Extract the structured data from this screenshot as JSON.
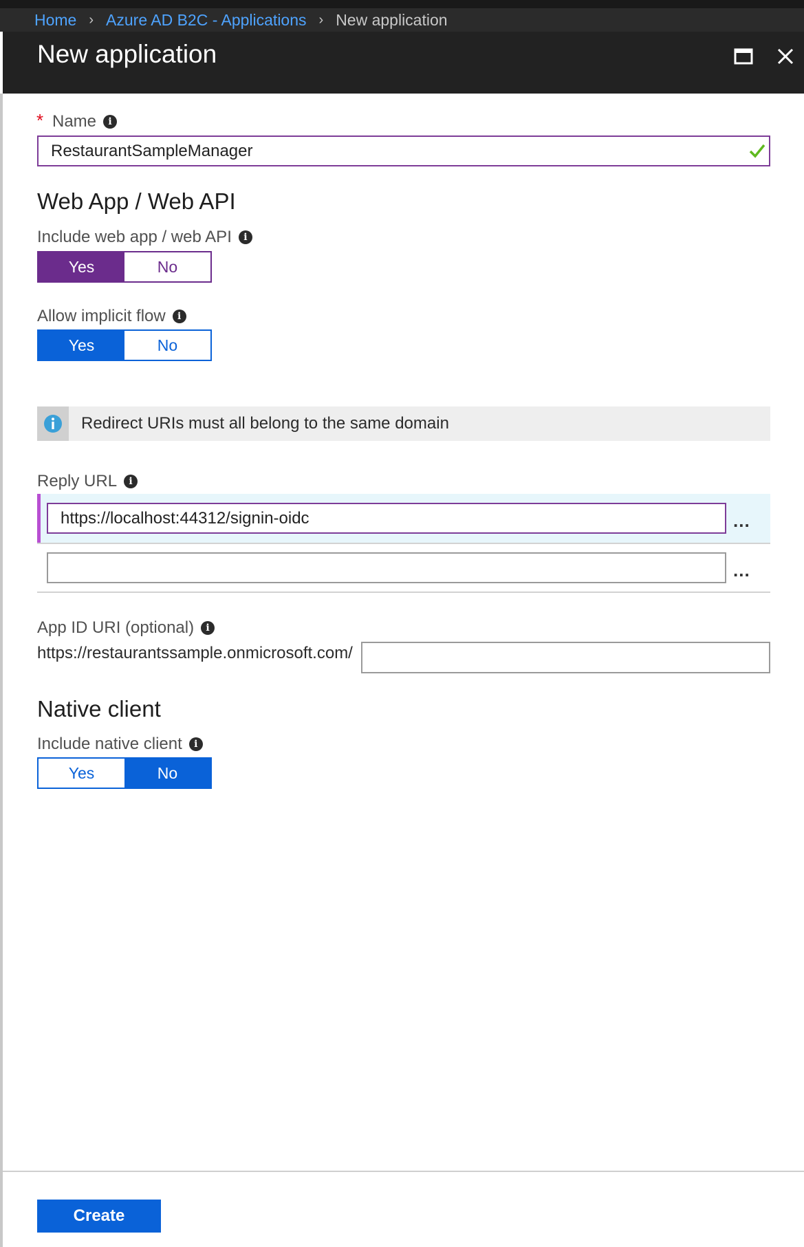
{
  "breadcrumb": {
    "items": [
      "Home",
      "Azure AD B2C - Applications",
      "New application"
    ]
  },
  "header": {
    "title": "New application"
  },
  "name_field": {
    "label": "Name",
    "required_mark": "*",
    "value": "RestaurantSampleManager",
    "valid": true
  },
  "web_app": {
    "section_title": "Web App / Web API",
    "include_label": "Include web app / web API",
    "include_options": [
      "Yes",
      "No"
    ],
    "include_selected": "Yes",
    "implicit_label": "Allow implicit flow",
    "implicit_options": [
      "Yes",
      "No"
    ],
    "implicit_selected": "Yes"
  },
  "info_banner": {
    "text": "Redirect URIs must all belong to the same domain",
    "icon": "info-icon"
  },
  "reply_url": {
    "label": "Reply URL",
    "values": [
      "https://localhost:44312/signin-oidc",
      ""
    ],
    "more_label": "..."
  },
  "app_id_uri": {
    "label": "App ID URI (optional)",
    "prefix": "https://restaurantssample.onmicrosoft.com/",
    "value": ""
  },
  "native_client": {
    "section_title": "Native client",
    "include_label": "Include native client",
    "include_options": [
      "Yes",
      "No"
    ],
    "include_selected": "No"
  },
  "footer": {
    "create_label": "Create"
  },
  "colors": {
    "accent_purple": "#6b2c8c",
    "accent_blue": "#0a62d8",
    "link_blue": "#4ea3ff",
    "valid_green": "#5fb91f"
  }
}
